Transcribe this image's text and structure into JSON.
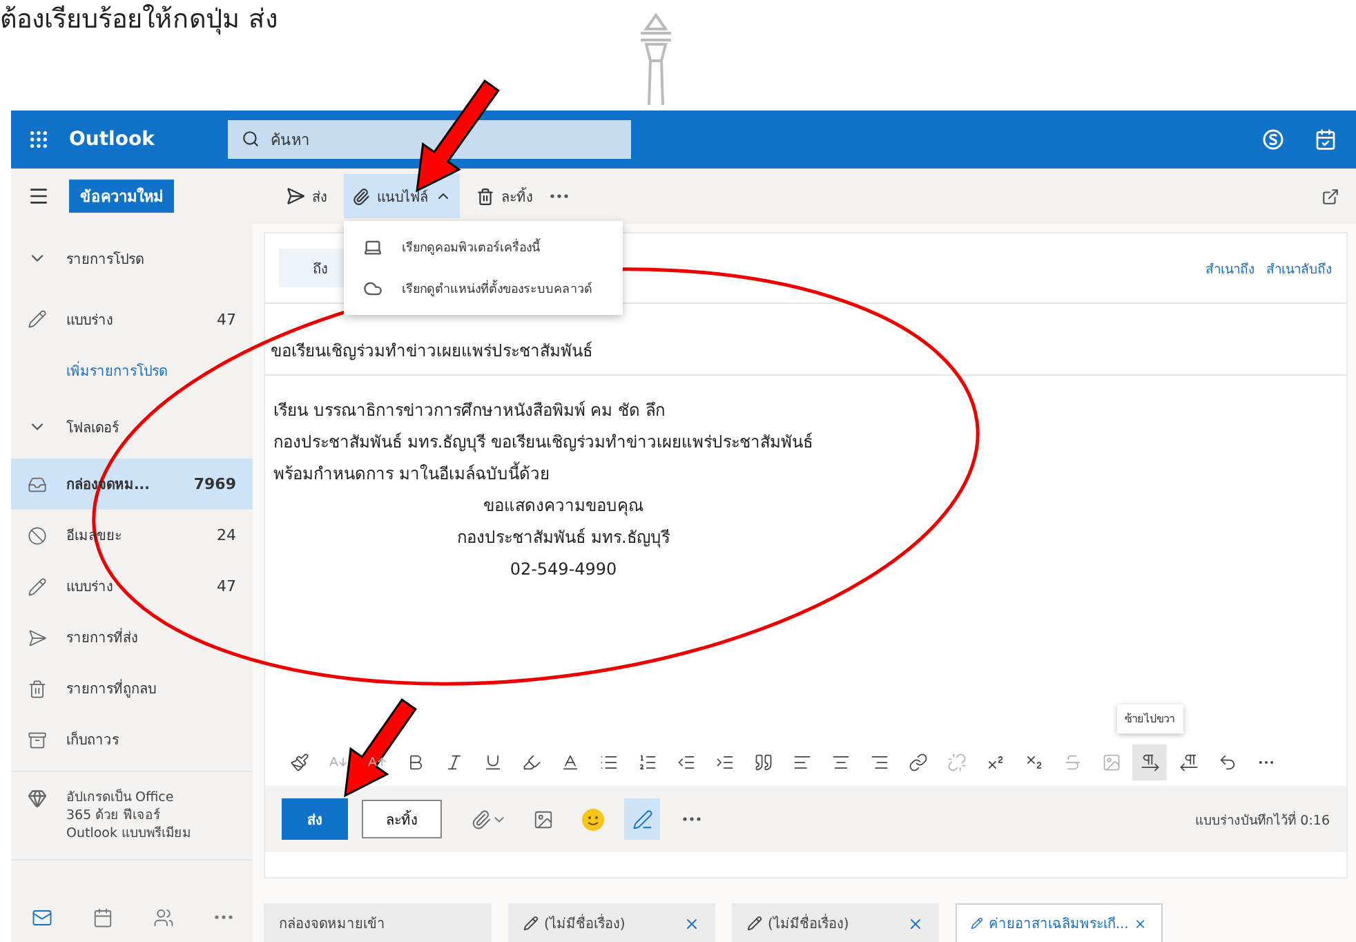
{
  "document": {
    "caption": "ต้องเรียบร้อยให้กดปุ่ม ส่ง"
  },
  "header": {
    "app_name": "Outlook",
    "search": {
      "placeholder": "ค้นหา"
    }
  },
  "sidebar": {
    "new_message": "ข้อความใหม่",
    "items": [
      {
        "kind": "section",
        "label": "รายการโปรด",
        "expanded": true
      },
      {
        "kind": "drafts",
        "label": "แบบร่าง",
        "count": "47",
        "selected": false
      },
      {
        "kind": "link",
        "label": "เพิ่มรายการโปรด"
      },
      {
        "kind": "section",
        "label": "โฟลเดอร์",
        "expanded": true
      },
      {
        "kind": "inbox",
        "label": "กล่องจดหม...",
        "count": "7969",
        "selected": true
      },
      {
        "kind": "junk",
        "label": "อีเมลขยะ",
        "count": "24",
        "selected": false
      },
      {
        "kind": "drafts",
        "label": "แบบร่าง",
        "count": "47",
        "selected": false
      },
      {
        "kind": "sent",
        "label": "รายการที่ส่ง",
        "selected": false
      },
      {
        "kind": "deleted",
        "label": "รายการที่ถูกลบ",
        "selected": false
      },
      {
        "kind": "archive",
        "label": "เก็บถาวร",
        "selected": false
      }
    ],
    "upgrade": [
      "อัปเกรดเป็น Office",
      "365 ด้วย ฟีเจอร์",
      "Outlook แบบพรีเมียม"
    ],
    "nav": [
      {
        "kind": "mail",
        "selected": true
      },
      {
        "kind": "calendar",
        "selected": false
      },
      {
        "kind": "people",
        "selected": false
      },
      {
        "kind": "more",
        "selected": false
      }
    ]
  },
  "toolbar": {
    "send": "ส่ง",
    "attach": {
      "label": "แนบไฟล์",
      "expanded": true
    },
    "discard": "ละทิ้ง",
    "attach_menu": [
      {
        "kind": "computer",
        "label": "เรียกดูคอมพิวเตอร์เครื่องนี้"
      },
      {
        "kind": "cloud",
        "label": "เรียกดูตำแหน่งที่ตั้งของระบบคลาวด์"
      }
    ]
  },
  "compose": {
    "to_label": "ถึง",
    "cc": "สำเนาถึง",
    "bcc": "สำเนาลับถึง",
    "subject": "ขอเรียนเชิญร่วมทำข่าวเผยแพร่ประชาสัมพันธ์",
    "body": [
      "เรียน บรรณาธิการข่าวการศึกษาหนังสือพิมพ์ คม ชัด ลึก",
      "กองประชาสัมพันธ์ มทร.ธัญบุรี ขอเรียนเชิญร่วมทำข่าวเผยแพร่ประชาสัมพันธ์",
      "พร้อมกำหนดการ มาในอีเมล์ฉบับนี้ด้วย"
    ],
    "signature": [
      "ขอแสดงความขอบคุณ",
      "กองประชาสัมพันธ์ มทร.ธัญบุรี",
      "02-549-4990"
    ]
  },
  "format_toolbar": [
    {
      "kind": "paintbrush",
      "selected": false,
      "disabled": false
    },
    {
      "kind": "shrink",
      "selected": false,
      "disabled": true
    },
    {
      "kind": "grow",
      "selected": false,
      "disabled": true
    },
    {
      "kind": "bold",
      "selected": false,
      "disabled": false
    },
    {
      "kind": "italic",
      "selected": false,
      "disabled": false
    },
    {
      "kind": "underline",
      "selected": false,
      "disabled": false
    },
    {
      "kind": "highlight",
      "selected": false,
      "disabled": false
    },
    {
      "kind": "fontcolor",
      "selected": false,
      "disabled": false
    },
    {
      "kind": "bullets",
      "selected": false,
      "disabled": false
    },
    {
      "kind": "numbering",
      "selected": false,
      "disabled": false
    },
    {
      "kind": "outdent",
      "selected": false,
      "disabled": false
    },
    {
      "kind": "indent",
      "selected": false,
      "disabled": false
    },
    {
      "kind": "quote",
      "selected": false,
      "disabled": false
    },
    {
      "kind": "alignleft",
      "selected": false,
      "disabled": false
    },
    {
      "kind": "aligncenter",
      "selected": false,
      "disabled": false
    },
    {
      "kind": "alignright",
      "selected": false,
      "disabled": false
    },
    {
      "kind": "link",
      "selected": false,
      "disabled": false
    },
    {
      "kind": "unlink",
      "selected": false,
      "disabled": true
    },
    {
      "kind": "superscript",
      "selected": false,
      "disabled": false
    },
    {
      "kind": "subscript",
      "selected": false,
      "disabled": false
    },
    {
      "kind": "strike",
      "selected": false,
      "disabled": true
    },
    {
      "kind": "image",
      "selected": false,
      "disabled": true
    },
    {
      "kind": "ltr",
      "selected": true,
      "disabled": false,
      "tooltip": "ซ้ายไปขวา"
    },
    {
      "kind": "rtl",
      "selected": false,
      "disabled": false
    },
    {
      "kind": "undo",
      "selected": false,
      "disabled": false
    },
    {
      "kind": "more",
      "selected": false,
      "disabled": false
    }
  ],
  "actions": {
    "send": "ส่ง",
    "discard": "ละทิ้ง",
    "tools": [
      {
        "kind": "attach",
        "selected": false
      },
      {
        "kind": "image",
        "selected": false
      },
      {
        "kind": "emoji",
        "selected": false
      },
      {
        "kind": "editor",
        "selected": true
      },
      {
        "kind": "more",
        "selected": false
      }
    ],
    "status": "แบบร่างบันทึกไว้ที่ 0:16"
  },
  "tabs": [
    {
      "kind": "folder",
      "label": "กล่องจดหมายเข้า",
      "selected": false
    },
    {
      "kind": "draft",
      "label": "(ไม่มีชื่อเรื่อง)",
      "selected": false
    },
    {
      "kind": "draft",
      "label": "(ไม่มีชื่อเรื่อง)",
      "selected": false
    },
    {
      "kind": "draft",
      "label": "ค่ายอาสาเฉลิมพระเกี...",
      "selected": true
    }
  ]
}
